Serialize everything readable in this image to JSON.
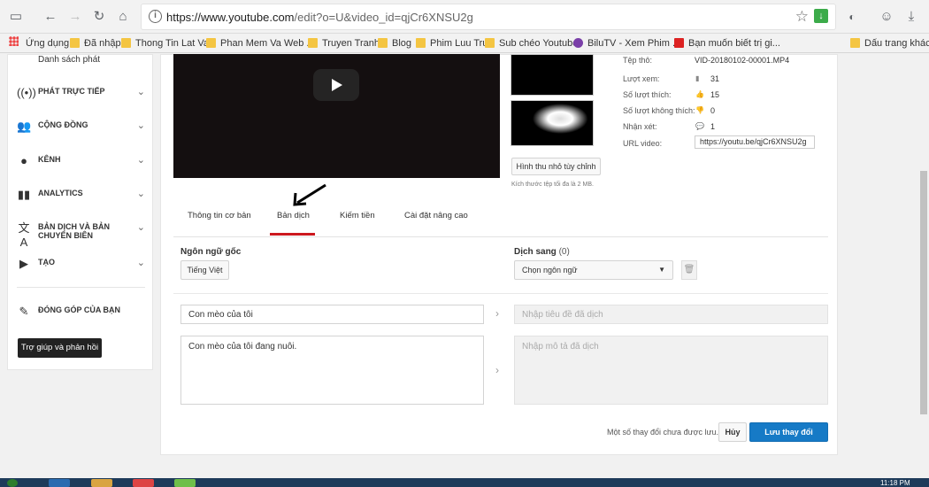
{
  "browser": {
    "url_prefix": "https://www.youtube.com",
    "url_rest": "/edit?o=U&video_id=qjCr6XNSU2g"
  },
  "bookmarks": [
    "Ứng dụng",
    "Đã nhập",
    "Thong Tin Lat Vat",
    "Phan Mem Va Web ...",
    "Truyen Tranh",
    "Blog",
    "Phim Luu Tru",
    "Sub chéo Youtube",
    "BiluTV - Xem Phim ...",
    "Bạn muốn biết trị gi...",
    "Dấu trang khác"
  ],
  "sidebar": {
    "playlist_label": "Danh sách phát",
    "items": [
      {
        "label": "PHÁT TRỰC TIẾP",
        "icon": "live-icon"
      },
      {
        "label": "CỘNG ĐỒNG",
        "icon": "community-icon"
      },
      {
        "label": "KÊNH",
        "icon": "channel-icon"
      },
      {
        "label": "ANALYTICS",
        "icon": "analytics-icon"
      },
      {
        "label": "BẢN DỊCH VÀ BẢN CHUYỂN BIÊN",
        "icon": "translate-icon"
      },
      {
        "label": "TẠO",
        "icon": "create-icon"
      }
    ],
    "contribute_label": "ĐÓNG GÓP CỦA BẠN",
    "help_button": "Trợ giúp và phản hồi"
  },
  "video": {
    "custom_thumb_button": "Hình thu nhỏ tùy chỉnh",
    "thumb_hint": "Kích thước tệp tối đa là 2 MB.",
    "meta": [
      {
        "label": "Tệp thô:",
        "value": "VID-20180102-00001.MP4"
      },
      {
        "label": "Lượt xem:",
        "value": "31"
      },
      {
        "label": "Số lượt thích:",
        "value": "15"
      },
      {
        "label": "Số lượt không thích:",
        "value": "0"
      },
      {
        "label": "Nhận xét:",
        "value": "1"
      },
      {
        "label": "URL video:",
        "value": "https://youtu.be/qjCr6XNSU2g"
      }
    ]
  },
  "tabs": [
    "Thông tin cơ bản",
    "Bản dịch",
    "Kiếm tiền",
    "Cài đặt nâng cao"
  ],
  "active_tab": "Bản dịch",
  "translation": {
    "original_lang_heading": "Ngôn ngữ gốc",
    "original_lang_value": "Tiếng Việt",
    "translate_to_heading": "Dịch sang",
    "translate_to_count": "(0)",
    "select_lang": "Chọn ngôn ngữ",
    "title_value": "Con mèo của tôi",
    "title_placeholder": "Nhập tiêu đề đã dịch",
    "desc_value": "Con mèo của tôi đang nuôi.",
    "desc_placeholder": "Nhập mô tả đã dịch"
  },
  "footer": {
    "unsaved_text": "Một số thay đổi chưa được lưu.",
    "cancel_label": "Hủy",
    "save_label": "Lưu thay đổi"
  },
  "taskbar": {
    "clock": "11:18 PM"
  },
  "colors": {
    "accent_red": "#cc181e",
    "save_blue": "#167ac6"
  }
}
